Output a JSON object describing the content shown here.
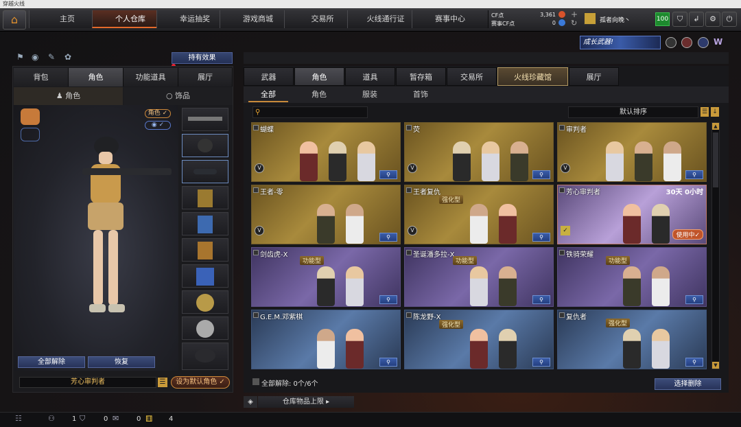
{
  "window": {
    "title": "穿越火线"
  },
  "nav": {
    "tabs": [
      {
        "label": "主页"
      },
      {
        "label": "个人仓库"
      },
      {
        "label": "幸运抽奖"
      },
      {
        "label": "游戏商城"
      },
      {
        "label": "交易所"
      },
      {
        "label": "火线通行证"
      },
      {
        "label": "赛事中心"
      }
    ]
  },
  "currency": {
    "cf_label": "CF点",
    "cf_value": "3,361",
    "vcf_label": "赛事CF点",
    "vcf_value": "0"
  },
  "user": {
    "name": "孤者向晚丶",
    "level": "100"
  },
  "banner": {
    "text": "成长武器!"
  },
  "left": {
    "effect_btn": "持有效果",
    "tabs": [
      {
        "label": "背包"
      },
      {
        "label": "角色"
      },
      {
        "label": "功能道具"
      },
      {
        "label": "展厅"
      }
    ],
    "subtabs": [
      {
        "label": "角色"
      },
      {
        "label": "饰品"
      }
    ],
    "badges": {
      "role": "角色",
      "eye": "◉"
    },
    "btn_unequip_all": "全部解除",
    "btn_restore": "恢复",
    "current_char": "芳心审判者",
    "btn_set_default": "设为默认角色"
  },
  "right": {
    "tabs": [
      {
        "label": "武器"
      },
      {
        "label": "角色"
      },
      {
        "label": "道具"
      },
      {
        "label": "暂存箱"
      },
      {
        "label": "交易所"
      },
      {
        "label": "火线珍藏馆"
      },
      {
        "label": "展厅"
      }
    ],
    "filters": [
      {
        "label": "全部"
      },
      {
        "label": "角色"
      },
      {
        "label": "服装"
      },
      {
        "label": "首饰"
      }
    ],
    "sort": "默认排序",
    "cards": [
      {
        "name": "蝴蝶",
        "style": "gold",
        "tag": "",
        "extra": ""
      },
      {
        "name": "荧",
        "style": "gold",
        "tag": "",
        "extra": ""
      },
      {
        "name": "审判者",
        "style": "gold",
        "tag": "",
        "extra": ""
      },
      {
        "name": "王者-零",
        "style": "gold",
        "tag": "",
        "extra": ""
      },
      {
        "name": "王者复仇",
        "style": "gold",
        "tag": "强化型",
        "extra": ""
      },
      {
        "name": "芳心审判者",
        "style": "pinkpurple",
        "tag": "",
        "extra": "30天 0小时",
        "badge": "使用中✓"
      },
      {
        "name": "剑齿虎-X",
        "style": "purple",
        "tag": "功能型",
        "extra": ""
      },
      {
        "name": "圣诞潘多拉-X",
        "style": "purple",
        "tag": "功能型",
        "extra": ""
      },
      {
        "name": "铁骑荣耀",
        "style": "purple",
        "tag": "功能型",
        "extra": ""
      },
      {
        "name": "G.E.M.邓紫棋",
        "style": "blue",
        "tag": "",
        "extra": ""
      },
      {
        "name": "陈龙野-X",
        "style": "blue",
        "tag": "强化型",
        "extra": ""
      },
      {
        "name": "复仇者",
        "style": "blue",
        "tag": "强化型",
        "extra": ""
      }
    ],
    "unequip_status": "全部解除: 0个/6个",
    "btn_delete": "选择删除",
    "capacity": "仓库物品上限"
  },
  "bottom": {
    "count1": "1",
    "count2": "0",
    "count3": "0",
    "count4": "4"
  }
}
